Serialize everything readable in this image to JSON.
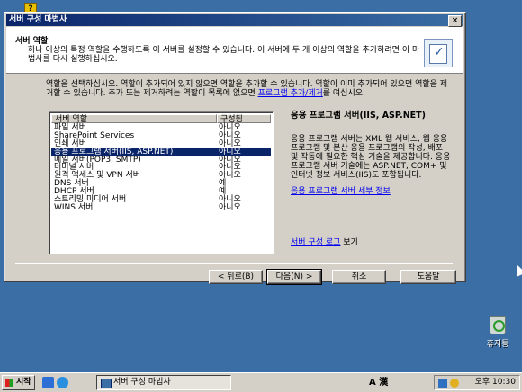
{
  "window": {
    "title": "서버 구성 마법사",
    "close_glyph": "×"
  },
  "desktop": {
    "help_badge": "?",
    "recycle_bin_label": "휴지통"
  },
  "header": {
    "title": "서버 역할",
    "description": "하나 이상의 특정 역할을 수행하도록 이 서버를 설정할 수 있습니다. 이 서버에 두 개 이상의 역할을 추가하려면 이 마법사를 다시 실행하십시오."
  },
  "intro": {
    "text_before_link": "역할을 선택하십시오. 역할이 추가되어 있지 않으면 역할을 추가할 수 있습니다. 역할이 이미 추가되어 있으면 역할을 제거할 수 있습니다. 추가 또는 제거하려는 역할이 목록에 없으면 ",
    "link": "프로그램 추가/제거",
    "text_after_link": "를 여십시오."
  },
  "roles_list": {
    "headers": [
      "서버 역할",
      "구성됨"
    ],
    "rows": [
      {
        "role": "파일 서버",
        "configured": "아니오"
      },
      {
        "role": "SharePoint Services",
        "configured": "아니오"
      },
      {
        "role": "인쇄 서버",
        "configured": "아니오"
      },
      {
        "role": "응용 프로그램 서버(IIS, ASP.NET)",
        "configured": "아니오",
        "selected": true
      },
      {
        "role": "메일 서버(POP3, SMTP)",
        "configured": "아니오"
      },
      {
        "role": "터미널 서버",
        "configured": "아니오"
      },
      {
        "role": "원격 액세스 및 VPN 서버",
        "configured": "아니오"
      },
      {
        "role": "DNS 서버",
        "configured": "예"
      },
      {
        "role": "DHCP 서버",
        "configured": "예"
      },
      {
        "role": "스트리밍 미디어 서버",
        "configured": "아니오"
      },
      {
        "role": "WINS 서버",
        "configured": "아니오"
      }
    ]
  },
  "detail": {
    "title": "응용 프로그램 서버(IIS, ASP.NET)",
    "text": "응용 프로그램 서버는 XML 웹 서비스, 웹 응용 프로그램 및 분산 응용 프로그램의 작성, 배포 및 작동에 필요한 핵심 기술을 제공합니다. 응용 프로그램 서버 기술에는 ASP.NET, COM+ 및 인터넷 정보 서비스(IIS)도 포함됩니다.",
    "details_link": "응용 프로그램 서버 세부 정보",
    "log_link": "서버 구성 로그",
    "log_suffix": " 보기"
  },
  "buttons": {
    "back": "< 뒤로(B)",
    "next": "다음(N) >",
    "cancel": "취소",
    "help": "도움말"
  },
  "taskbar": {
    "start_label": "시작",
    "task_label": "서버 구성 마법사",
    "lang_indicator": "A 漢",
    "clock": "오후 10:30"
  }
}
